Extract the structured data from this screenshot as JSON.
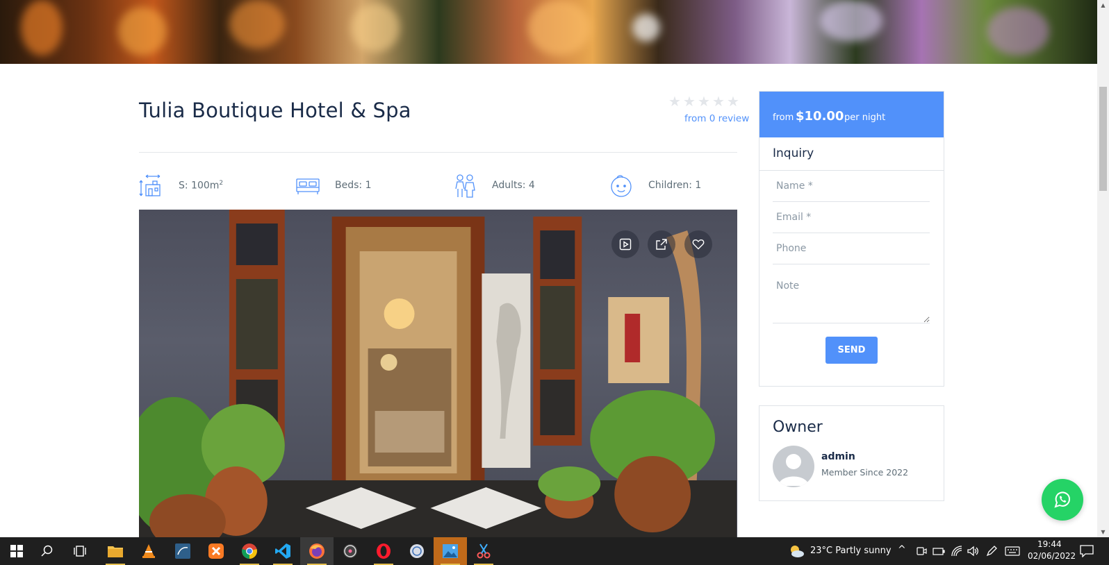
{
  "hotel": {
    "title": "Tulia Boutique Hotel & Spa",
    "rating_stars": 0,
    "rating_max": 5,
    "review_text": "from 0 review"
  },
  "features": [
    {
      "icon": "size-icon",
      "label": "S: 100m",
      "sup": "2"
    },
    {
      "icon": "bed-icon",
      "label": "Beds: 1",
      "sup": ""
    },
    {
      "icon": "adults-icon",
      "label": "Adults: 4",
      "sup": ""
    },
    {
      "icon": "child-icon",
      "label": "Children: 1",
      "sup": ""
    }
  ],
  "gallery": {
    "buttons": [
      "video-icon",
      "share-icon",
      "heart-icon"
    ]
  },
  "booking": {
    "from_label": "from",
    "price": "$10.00",
    "unit": "per night",
    "inquiry_title": "Inquiry",
    "name_placeholder": "Name *",
    "email_placeholder": "Email *",
    "phone_placeholder": "Phone",
    "note_placeholder": "Note",
    "send_label": "SEND"
  },
  "owner": {
    "title": "Owner",
    "name": "admin",
    "since": "Member Since 2022"
  },
  "colors": {
    "accent": "#5191fa",
    "heading": "#1a2b48",
    "text": "#5e6d77",
    "whatsapp": "#25d366",
    "taskbar": "#1f1f1f"
  },
  "taskbar": {
    "weather": "23°C  Partly sunny",
    "time": "19:44",
    "date": "02/06/2022"
  }
}
